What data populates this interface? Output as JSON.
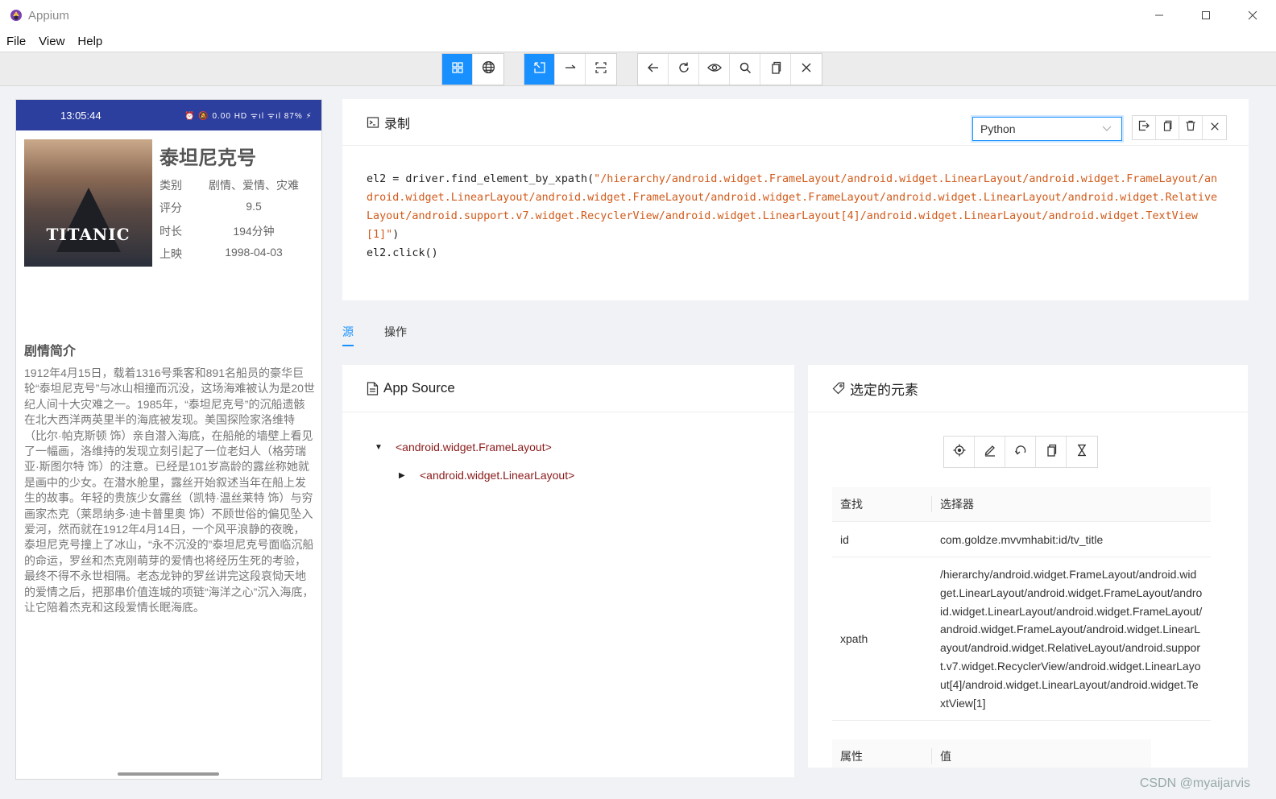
{
  "window": {
    "title": "Appium",
    "minimize": "—",
    "maximize": "☐",
    "close": "✕"
  },
  "menu": [
    "File",
    "View",
    "Help"
  ],
  "phone": {
    "time": "13:05:44",
    "status_icons": "⏰ 🔕 0.00 HD ᯤıl ᯤıl 87% ⚡",
    "poster_text": "TITANIC",
    "movie_title": "泰坦尼克号",
    "info": [
      {
        "label": "类别",
        "value": "剧情、爱情、灾难"
      },
      {
        "label": "评分",
        "value": "9.5"
      },
      {
        "label": "时长",
        "value": "194分钟"
      },
      {
        "label": "上映",
        "value": "1998-04-03"
      }
    ],
    "synopsis_title": "剧情简介",
    "synopsis": "1912年4月15日，载着1316号乘客和891名船员的豪华巨轮“泰坦尼克号”与冰山相撞而沉没，这场海难被认为是20世纪人间十大灾难之一。1985年，“泰坦尼克号”的沉船遗骸在北大西洋两英里半的海底被发现。美国探险家洛维特（比尔·帕克斯顿 饰）亲自潜入海底，在船舱的墙壁上看见了一幅画，洛维持的发现立刻引起了一位老妇人（格劳瑞亚·斯图尔特 饰）的注意。已经是101岁高龄的露丝称她就是画中的少女。在潜水舱里，露丝开始叙述当年在船上发生的故事。年轻的贵族少女露丝（凯特·温丝莱特 饰）与穷画家杰克（莱昂纳多·迪卡普里奥 饰）不顾世俗的偏见坠入爱河，然而就在1912年4月14日，一个风平浪静的夜晚，泰坦尼克号撞上了冰山，“永不沉没的”泰坦尼克号面临沉船的命运，罗丝和杰克刚萌芽的爱情也将经历生死的考验，最终不得不永世相隔。老态龙钟的罗丝讲完这段哀恸天地的爱情之后，把那串价值连城的项链“海洋之心”沉入海底，让它陪着杰克和这段爱情长眠海底。"
  },
  "recorder": {
    "title": "录制",
    "language": "Python",
    "code_line1_prefix": "el2 = driver.find_element_by_xpath(",
    "code_line1_string": "\"/hierarchy/android.widget.FrameLayout/android.widget.LinearLayout/android.widget.FrameLayout/android.widget.LinearLayout/android.widget.FrameLayout/android.widget.FrameLayout/android.widget.LinearLayout/android.widget.RelativeLayout/android.support.v7.widget.RecyclerView/android.widget.LinearLayout[4]/android.widget.LinearLayout/android.widget.TextView[1]\"",
    "code_line1_suffix": ")",
    "code_line2": "el2.click()"
  },
  "tabs": [
    "源",
    "操作"
  ],
  "source": {
    "title": "App Source",
    "nodes": [
      "<android.widget.FrameLayout>",
      "<android.widget.LinearLayout>"
    ]
  },
  "selected": {
    "title": "选定的元素",
    "table_header": {
      "key": "查找",
      "value": "选择器"
    },
    "rows": [
      {
        "key": "id",
        "value": "com.goldze.mvvmhabit:id/tv_title"
      },
      {
        "key": "xpath",
        "value": "/hierarchy/android.widget.FrameLayout/android.widget.LinearLayout/android.widget.FrameLayout/android.widget.LinearLayout/android.widget.FrameLayout/android.widget.FrameLayout/android.widget.LinearLayout/android.widget.RelativeLayout/android.support.v7.widget.RecyclerView/android.widget.LinearLayout[4]/android.widget.LinearLayout/android.widget.TextView[1]"
      }
    ],
    "attr_header": {
      "key": "属性",
      "value": "值"
    }
  },
  "watermark": "CSDN @myaijarvis",
  "colors": {
    "accent": "#1890ff",
    "status_bar": "#2c3e9e",
    "code_string": "#d15a1a",
    "tree_tag": "#8b1a1a"
  }
}
